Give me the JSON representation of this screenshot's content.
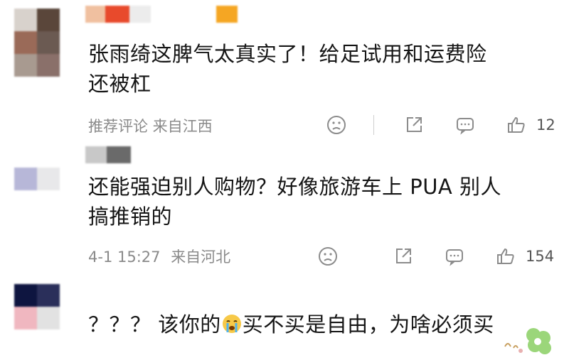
{
  "comments": [
    {
      "text_line1": "张雨绮这脾气太真实了！给足试用和运费险",
      "text_line2": "还被杠",
      "time": "",
      "source": "推荐评论  来自江西",
      "likes": "12"
    },
    {
      "text_line1": "还能强迫别人购物？好像旅游车上 PUA 别人",
      "text_line2": "搞推销的",
      "time": "4-1 15:27",
      "source": "来自河北",
      "likes": "154"
    },
    {
      "text_prefix": "？？？ 该你的",
      "emoji": "crying-face-icon",
      "text_suffix": "买不买是自由，为啥必须买"
    }
  ],
  "colors": {
    "avatar1": [
      "#d8d2cc",
      "#5a463a",
      "#9a6a58",
      "#6b5a52",
      "#a89a90",
      "#8a706a"
    ],
    "avatar2": [
      "#b7b7d8",
      "#e8e8ea"
    ],
    "avatar3": [
      "#0e1540",
      "#2a2f5a",
      "#f0b7c0",
      "#e2e2e2"
    ],
    "name_bars": [
      "#f0c0a0",
      "#e84a2c",
      "#ececec",
      "#f5a623",
      "#c8c8c8",
      "#6a6a6a"
    ],
    "icon_gray": "#8c8c8c"
  }
}
